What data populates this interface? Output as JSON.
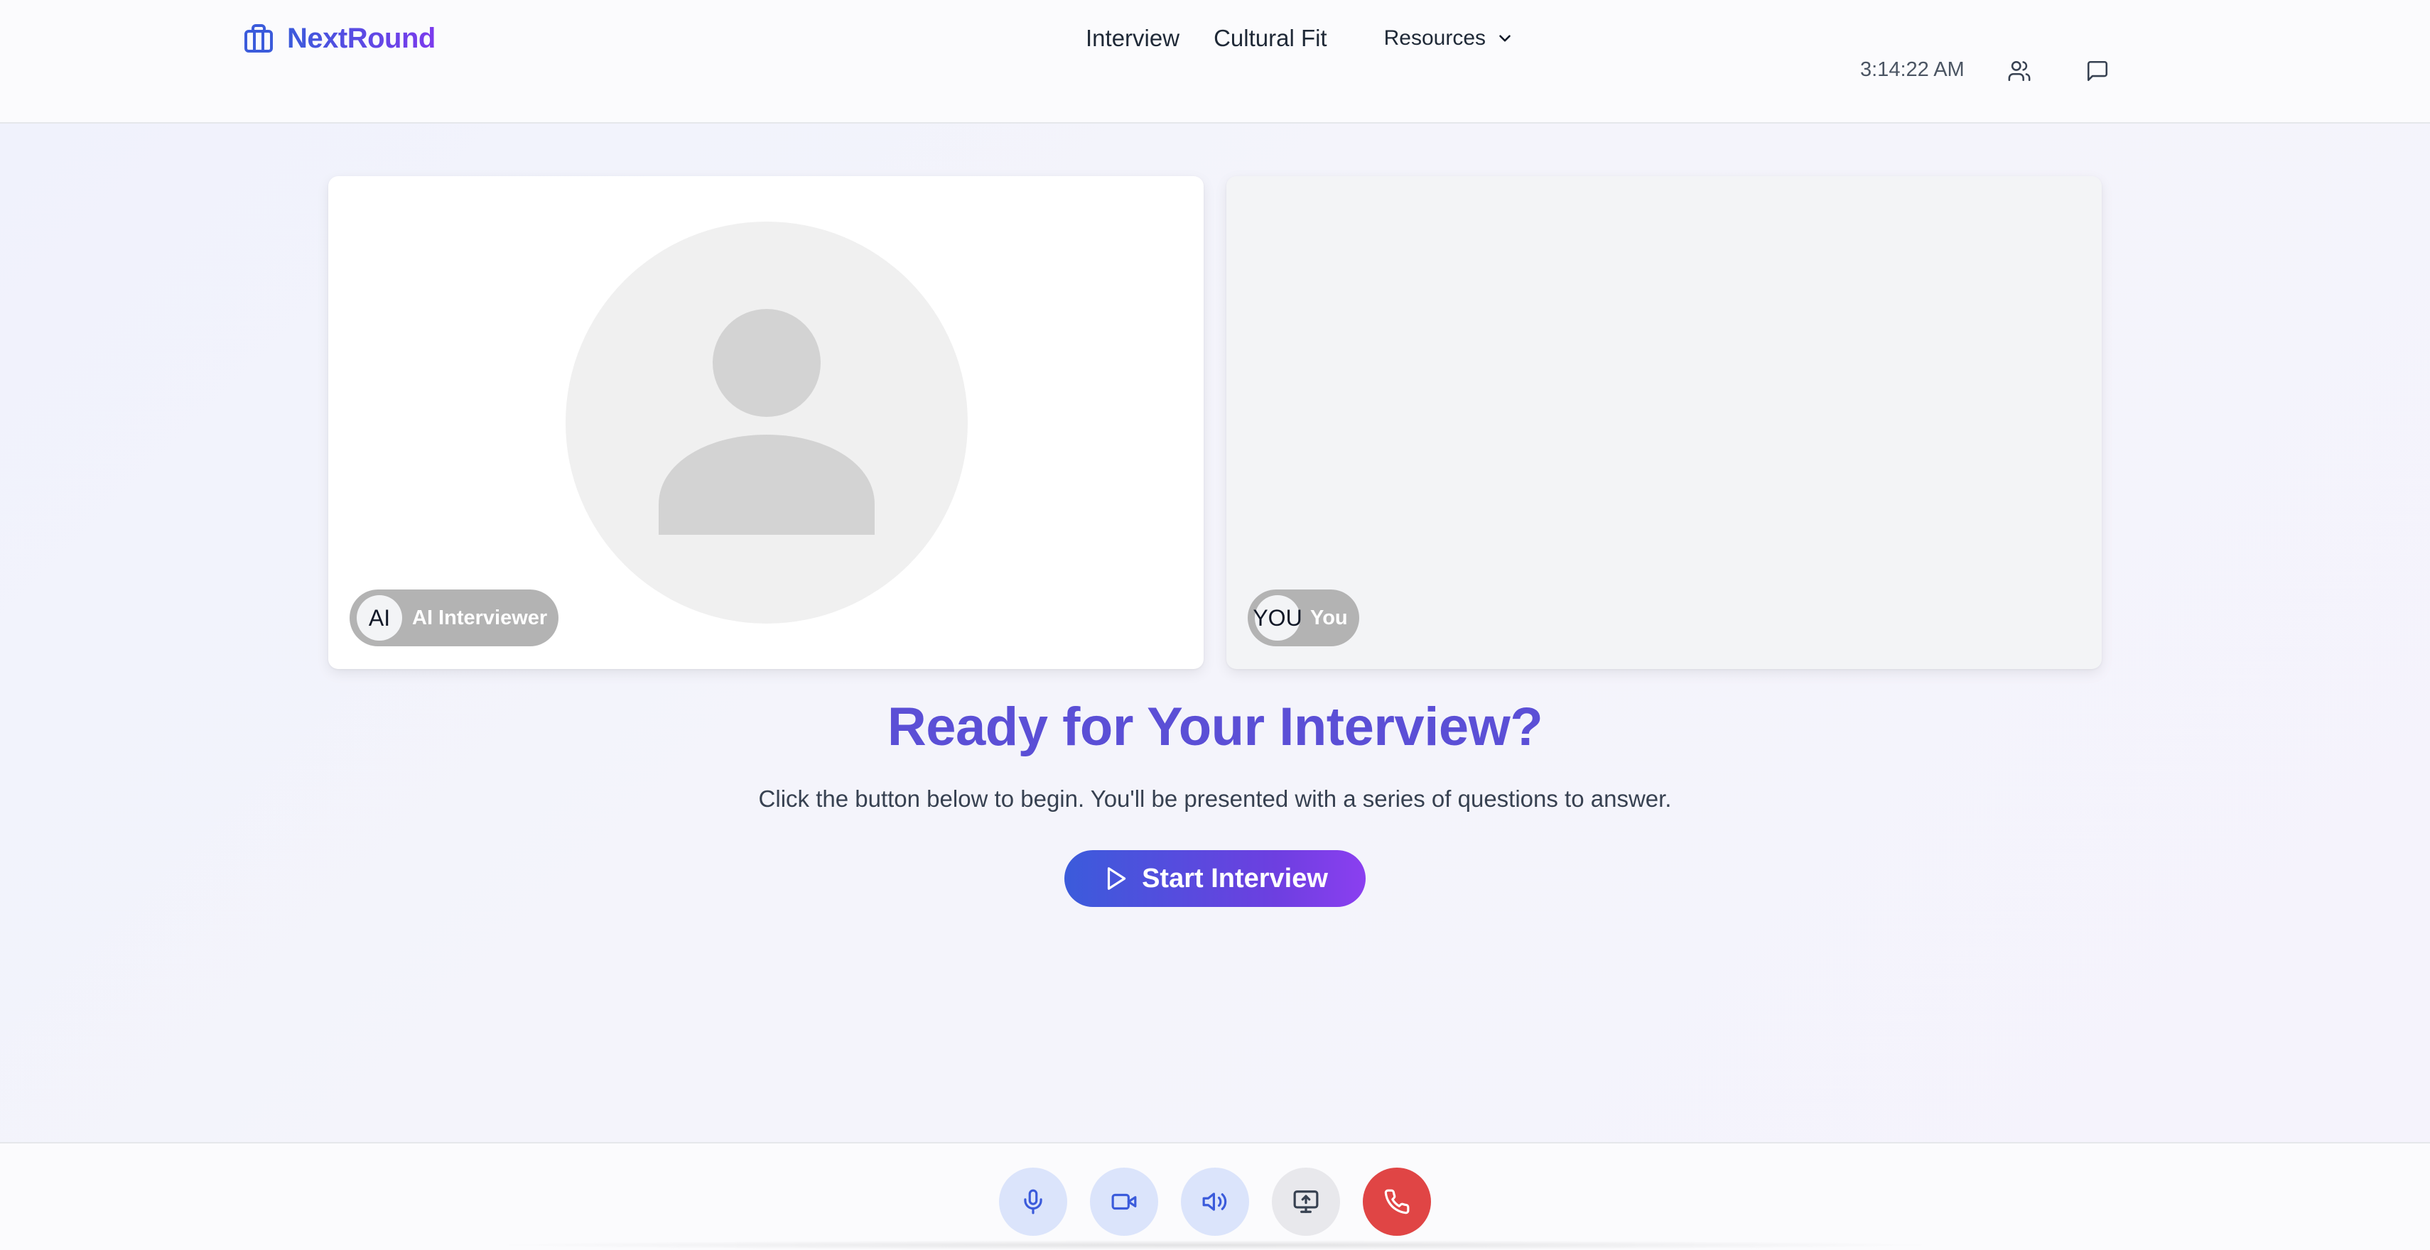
{
  "header": {
    "brand": "NextRound",
    "nav": [
      {
        "label": "Interview"
      },
      {
        "label": "Cultural Fit"
      }
    ],
    "resources_label": "Resources",
    "time": "3:14:22 AM",
    "icons": [
      "users-icon",
      "message-icon"
    ]
  },
  "panels": {
    "ai": {
      "badge": "AI",
      "name": "AI Interviewer"
    },
    "you": {
      "badge": "YOU",
      "name": "You"
    }
  },
  "main": {
    "title": "Ready for Your Interview?",
    "subtitle": "Click the button below to begin. You'll be presented with a series of questions to answer.",
    "start_label": "Start Interview"
  },
  "controls": [
    "microphone-icon",
    "video-camera-icon",
    "speaker-icon",
    "screen-share-icon",
    "phone-end-icon"
  ],
  "colors": {
    "brand_start": "#3b5bdb",
    "brand_end": "#7c3aed",
    "title": "#5b4fd6",
    "end_call": "#e04545",
    "control_active": "#dbe4fb"
  }
}
